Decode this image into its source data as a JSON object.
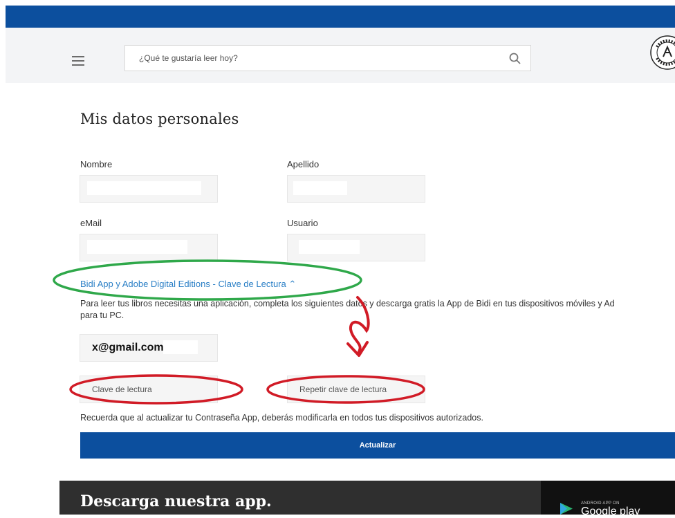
{
  "header": {
    "search_placeholder": "¿Qué te gustaría leer hoy?"
  },
  "page": {
    "title": "Mis datos personales"
  },
  "form": {
    "nombre_label": "Nombre",
    "apellido_label": "Apellido",
    "email_label": "eMail",
    "usuario_label": "Usuario"
  },
  "reading_key": {
    "section_label": "Bidi App y Adobe Digital Editions - Clave de Lectura ⌃",
    "intro_line1": "Para leer tus libros necesitas una aplicación, completa los siguientes datos y descarga gratis la App de Bidi en tus dispositivos móviles y Ad",
    "intro_line2": "para tu PC.",
    "email_value": "x@gmail.com",
    "password_placeholder": "Clave de lectura",
    "repeat_placeholder": "Repetir clave de lectura",
    "note": "Recuerda que al actualizar tu Contraseña App, deberás modificarla en todos tus dispositivos autorizados.",
    "update_label": "Actualizar"
  },
  "footer": {
    "title": "Descarga nuestra app.",
    "store_small": "ANDROID APP ON",
    "store_big": "Google play"
  },
  "colors": {
    "brand_blue": "#0c4f9e",
    "link_blue": "#2a7fc6",
    "annotation_green": "#2fa84a",
    "annotation_red": "#d11b26"
  }
}
